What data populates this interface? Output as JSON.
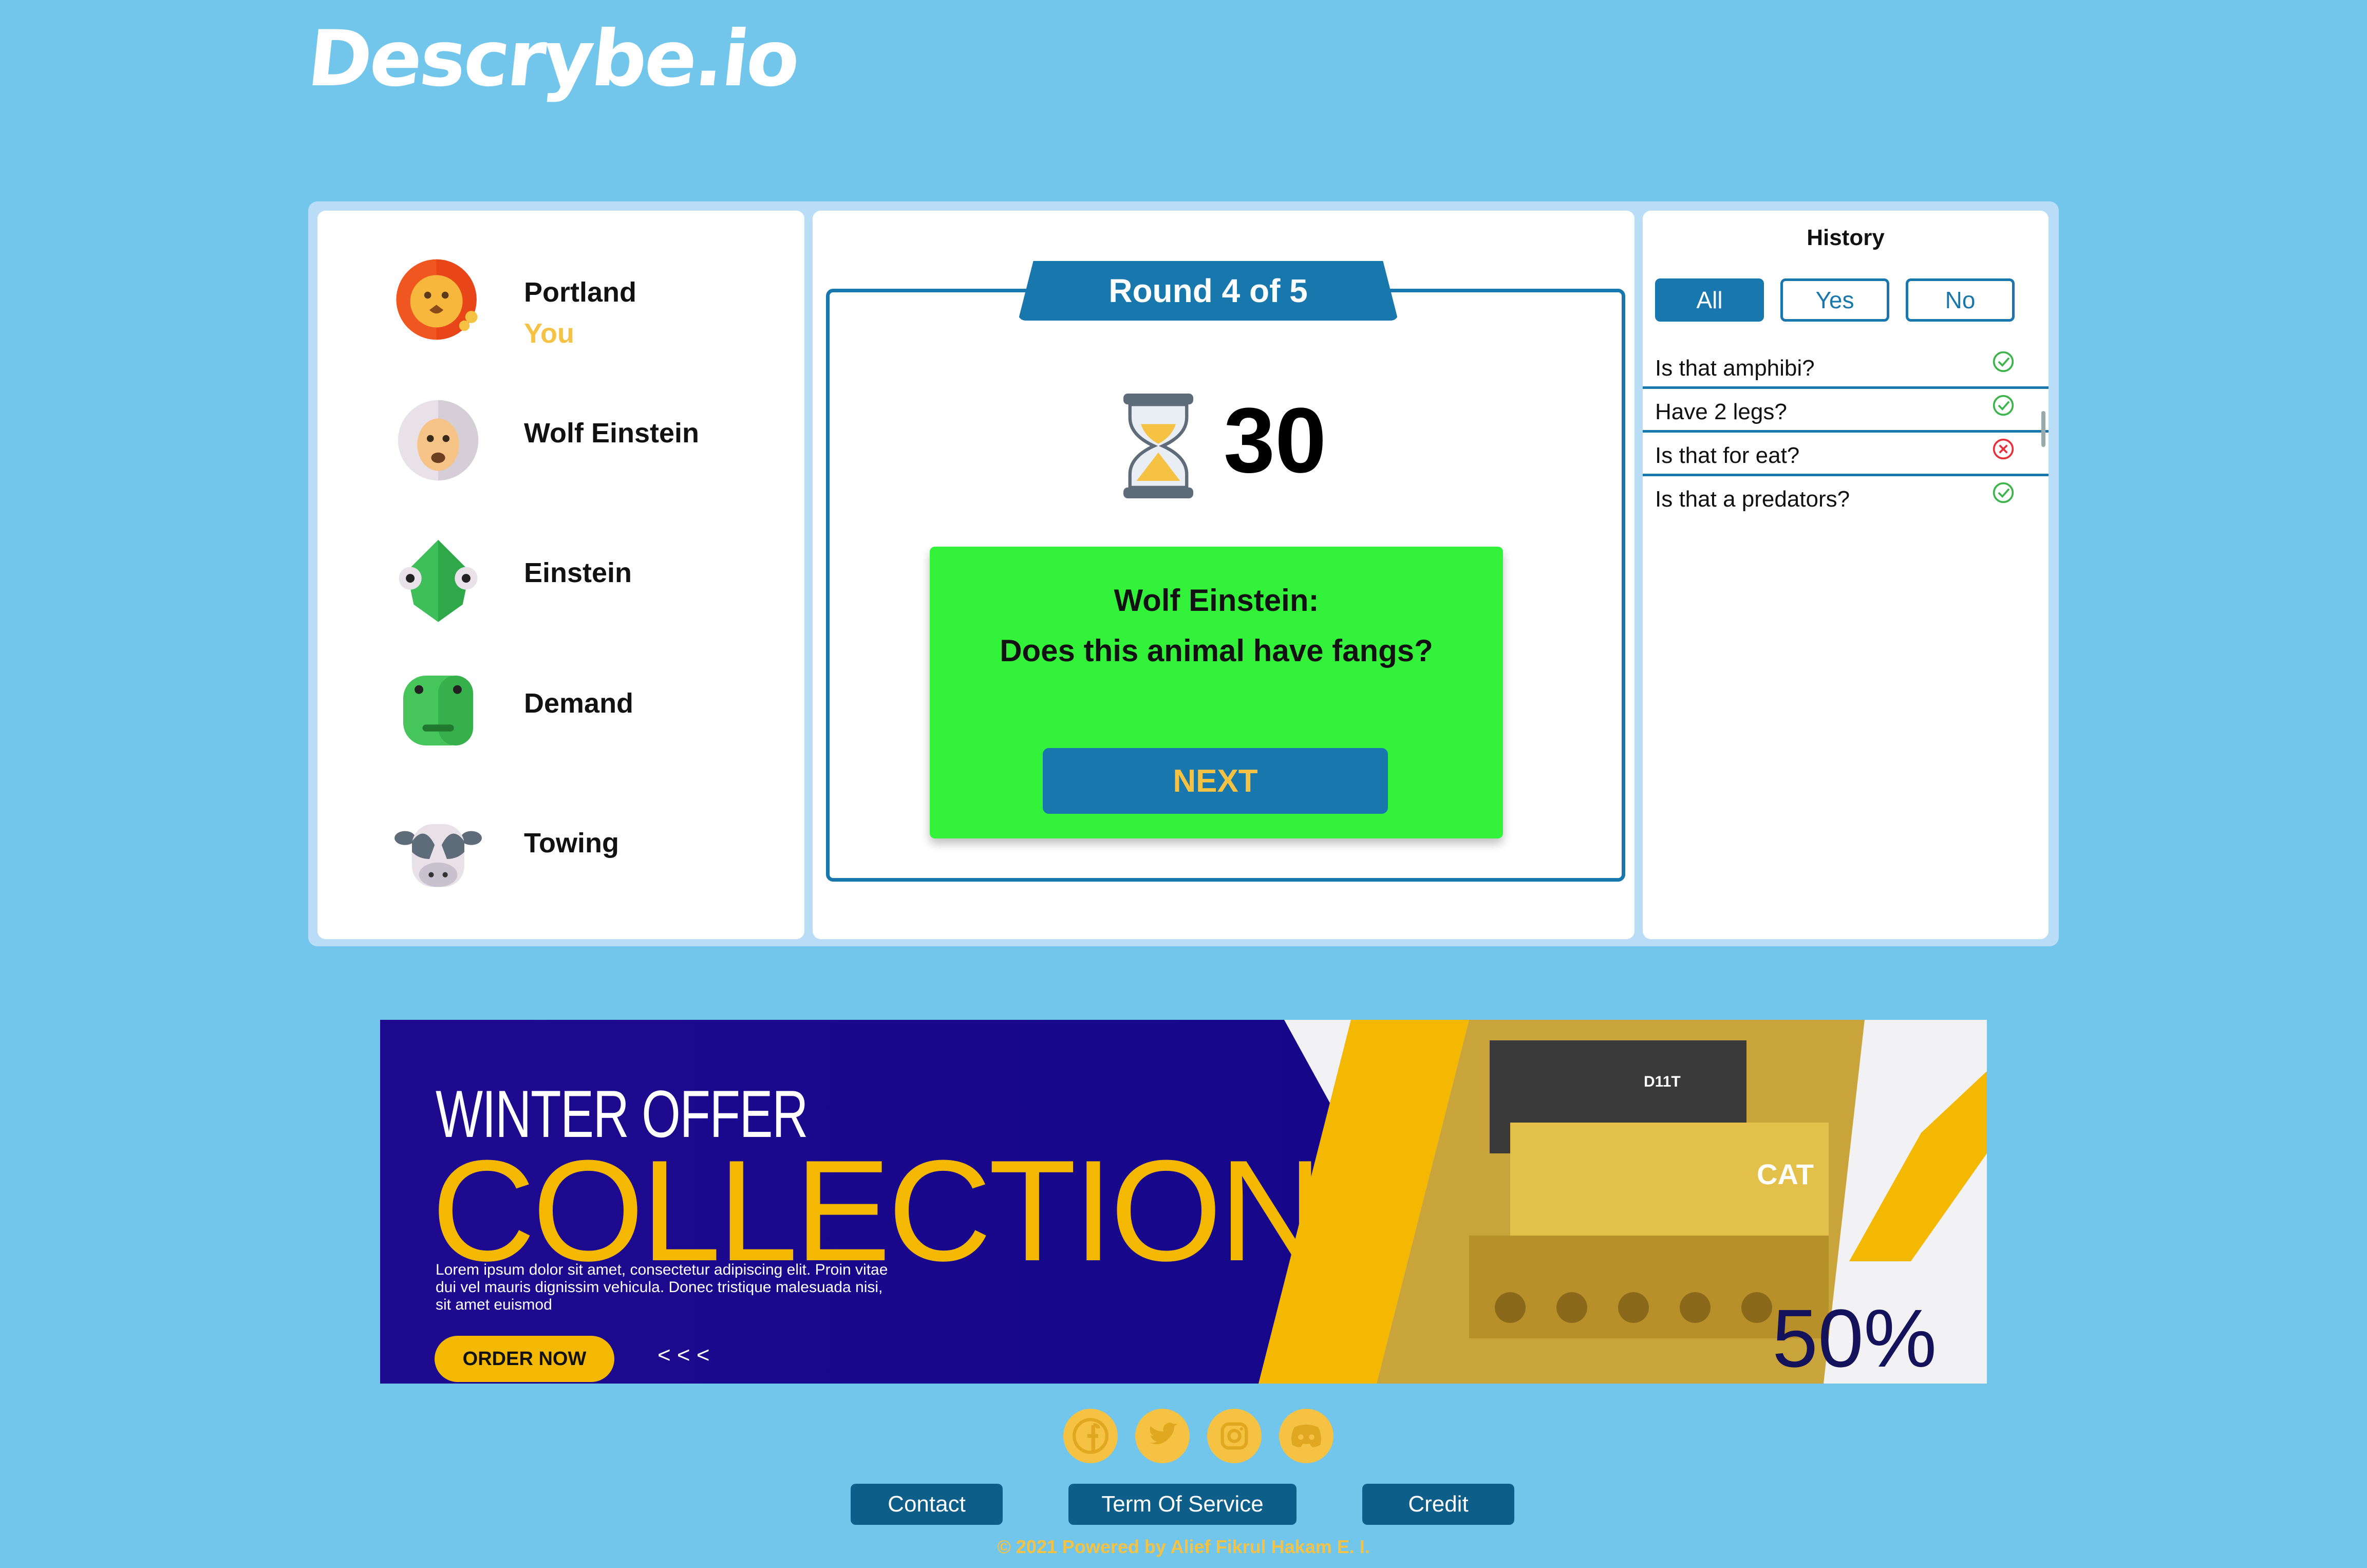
{
  "app": {
    "logo": "Descrybe.io"
  },
  "players": [
    {
      "name": "Portland",
      "tag": "You",
      "avatar": "lion-icon"
    },
    {
      "name": "Wolf Einstein",
      "tag": "",
      "avatar": "sheep-icon"
    },
    {
      "name": "Einstein",
      "tag": "",
      "avatar": "chameleon-icon"
    },
    {
      "name": "Demand",
      "tag": "",
      "avatar": "frog-icon"
    },
    {
      "name": "Towing",
      "tag": "",
      "avatar": "cow-icon"
    }
  ],
  "round": {
    "label": "Round 4 of 5"
  },
  "timer": {
    "value": "30",
    "icon": "hourglass-icon"
  },
  "question": {
    "asker": "Wolf Einstein:",
    "text": "Does this animal have fangs?",
    "next_label": "NEXT"
  },
  "history": {
    "title": "History",
    "filters": [
      "All",
      "Yes",
      "No"
    ],
    "active_filter": "All",
    "items": [
      {
        "text": "Is that amphibi?",
        "answer": "yes"
      },
      {
        "text": "Have 2 legs?",
        "answer": "yes"
      },
      {
        "text": "Is that for eat?",
        "answer": "no"
      },
      {
        "text": "Is that a predators?",
        "answer": "yes"
      }
    ]
  },
  "banner": {
    "headline_small": "WINTER OFFER",
    "headline_big": "COLLECTION",
    "body": "Lorem ipsum dolor sit amet, consectetur adipiscing elit. Proin vitae dui vel mauris dignissim vehicula. Donec tristique malesuada nisi, sit amet euismod",
    "cta": "ORDER NOW",
    "arrows": "< < <",
    "discount": "50%",
    "photo_text_1": "D11T",
    "photo_text_2": "CAT"
  },
  "social": [
    "facebook-icon",
    "twitter-icon",
    "instagram-icon",
    "discord-icon"
  ],
  "footer": {
    "links": [
      "Contact",
      "Term Of Service",
      "Credit"
    ],
    "copyright": "© 2021 Powered by Alief Fikrul Hakam E. I."
  },
  "colors": {
    "background": "#72c6eb",
    "primary": "#1878ae",
    "accent": "#f6c243",
    "question_card": "#33f23a",
    "yes": "#3bb54a",
    "no": "#e8303a"
  }
}
